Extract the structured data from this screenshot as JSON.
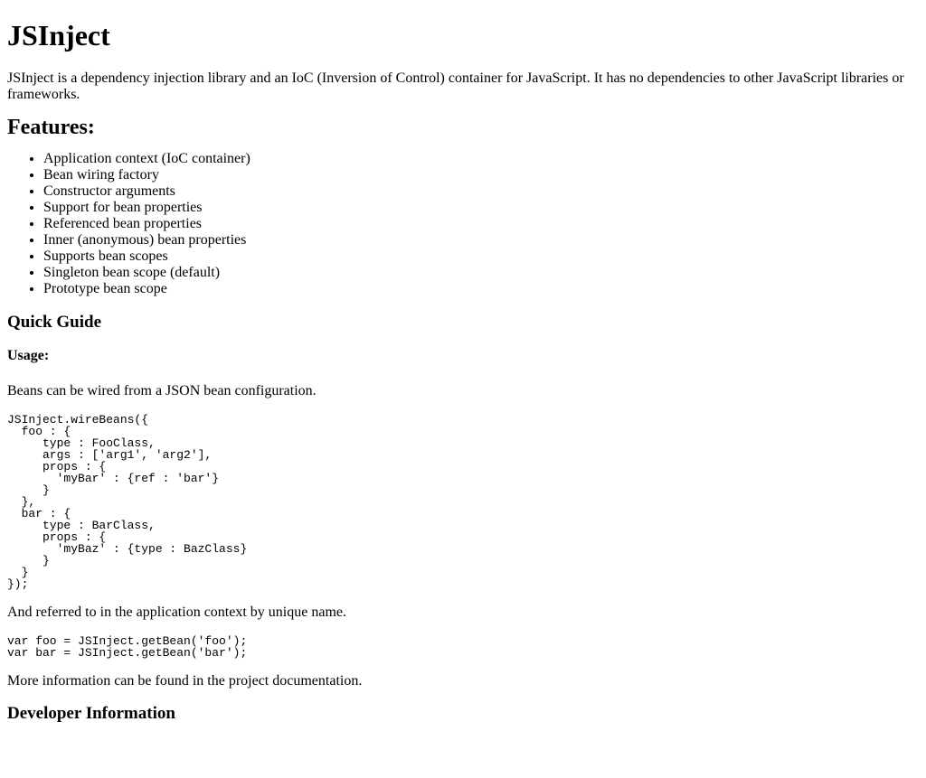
{
  "title": "JSInject",
  "intro": "JSInject is a dependency injection library and an IoC (Inversion of Control) container for JavaScript. It has no dependencies to other JavaScript libraries or frameworks.",
  "features": {
    "heading": "Features:",
    "items": [
      "Application context (IoC container)",
      "Bean wiring factory",
      "Constructor arguments",
      "Support for bean properties",
      "Referenced bean properties",
      "Inner (anonymous) bean properties",
      "Supports bean scopes",
      "Singleton bean scope (default)",
      "Prototype bean scope"
    ]
  },
  "quick_guide": {
    "heading": "Quick Guide",
    "usage_heading": "Usage:",
    "wire_text": "Beans can be wired from a JSON bean configuration.",
    "wire_code": "JSInject.wireBeans({\n  foo : {\n     type : FooClass,\n     args : ['arg1', 'arg2'],\n     props : {\n       'myBar' : {ref : 'bar'}\n     }\n  },\n  bar : {\n     type : BarClass,\n     props : {\n       'myBaz' : {type : BazClass}\n     }\n  }\n});",
    "refer_text": "And referred to in the application context by unique name.",
    "refer_code": "var foo = JSInject.getBean('foo');\nvar bar = JSInject.getBean('bar');",
    "more_info": "More information can be found in the project documentation."
  },
  "developer": {
    "heading": "Developer Information"
  }
}
